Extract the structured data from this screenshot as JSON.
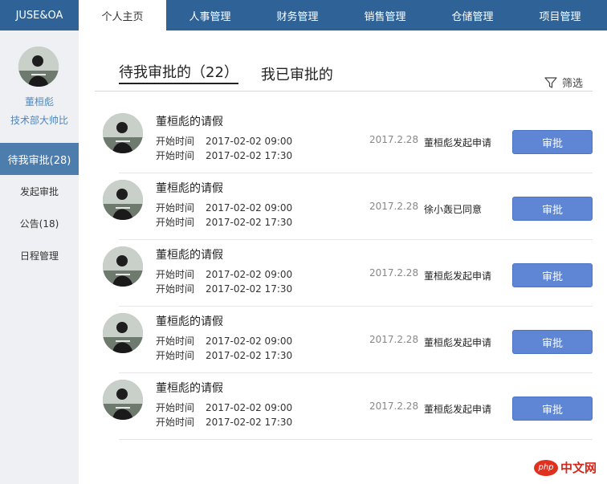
{
  "brand": "JUSE&OA",
  "nav": {
    "tabs": [
      {
        "label": "个人主页"
      },
      {
        "label": "人事管理"
      },
      {
        "label": "财务管理"
      },
      {
        "label": "销售管理"
      },
      {
        "label": "仓储管理"
      },
      {
        "label": "项目管理"
      }
    ]
  },
  "user": {
    "name": "董桓彪",
    "title": "技术部大帅比"
  },
  "sidebar": {
    "items": [
      {
        "label": "待我审批(28)"
      },
      {
        "label": "发起审批"
      },
      {
        "label": "公告(18)"
      },
      {
        "label": "日程管理"
      }
    ]
  },
  "tabs": {
    "pending_label": "待我审批的（22）",
    "done_label": "我已审批的",
    "filter_label": "筛选"
  },
  "approvals": [
    {
      "title": "董桓彪的请假",
      "start_label": "开始时间",
      "start": "2017-02-02 09:00",
      "end_label": "开始时间",
      "end": "2017-02-02 17:30",
      "date": "2017.2.28",
      "status": "董桓彪发起申请",
      "button": "审批"
    },
    {
      "title": "董桓彪的请假",
      "start_label": "开始时间",
      "start": "2017-02-02 09:00",
      "end_label": "开始时间",
      "end": "2017-02-02 17:30",
      "date": "2017.2.28",
      "status": "徐小轰已同意",
      "button": "审批"
    },
    {
      "title": "董桓彪的请假",
      "start_label": "开始时间",
      "start": "2017-02-02 09:00",
      "end_label": "开始时间",
      "end": "2017-02-02 17:30",
      "date": "2017.2.28",
      "status": "董桓彪发起申请",
      "button": "审批"
    },
    {
      "title": "董桓彪的请假",
      "start_label": "开始时间",
      "start": "2017-02-02 09:00",
      "end_label": "开始时间",
      "end": "2017-02-02 17:30",
      "date": "2017.2.28",
      "status": "董桓彪发起申请",
      "button": "审批"
    },
    {
      "title": "董桓彪的请假",
      "start_label": "开始时间",
      "start": "2017-02-02 09:00",
      "end_label": "开始时间",
      "end": "2017-02-02 17:30",
      "date": "2017.2.28",
      "status": "董桓彪发起申请",
      "button": "审批"
    }
  ],
  "watermark": {
    "logo": "php",
    "text": "中文网"
  },
  "colors": {
    "topbar": "#2f6397",
    "sidebar_bg": "#eef0f3",
    "sidebar_active": "#4d7dad",
    "link": "#4e86bd",
    "button": "#5f86d4"
  }
}
